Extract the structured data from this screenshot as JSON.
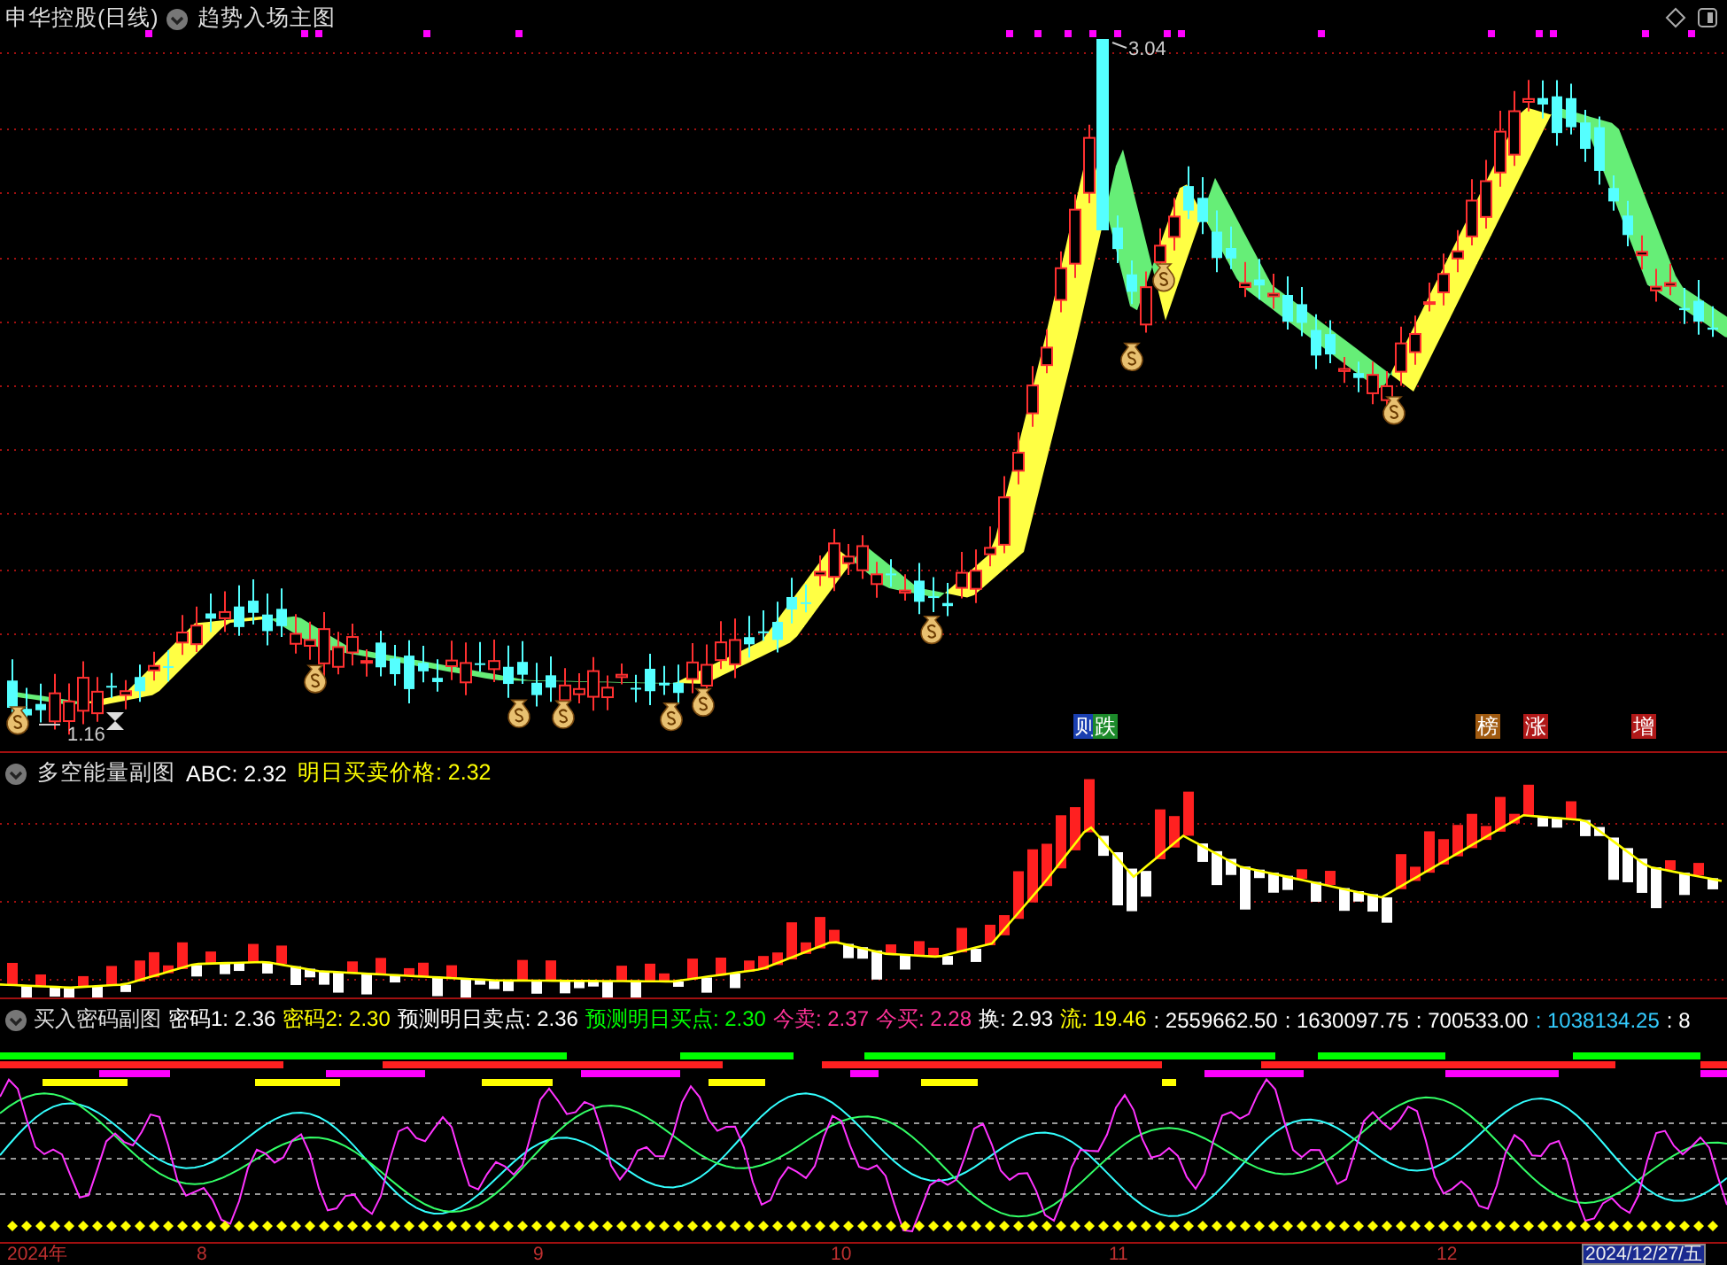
{
  "main_panel": {
    "stock_name": "申华控股(日线)",
    "indicator": "趋势入场主图",
    "high_label": "3.04",
    "low_label": "1.16",
    "signals": [
      {
        "text": "则",
        "color": "#1a3fb0"
      },
      {
        "text": "跌",
        "color": "#1c8a2a"
      },
      {
        "text": "榜",
        "color": "#a05a10"
      },
      {
        "text": "涨",
        "color": "#b01818"
      },
      {
        "text": "增",
        "color": "#b01818"
      }
    ]
  },
  "energy_panel": {
    "title": "多空能量副图",
    "values": [
      {
        "text": "ABC: 2.32",
        "color": "#ffffff"
      },
      {
        "text": "明日买卖价格: 2.32",
        "color": "#ffff00"
      }
    ]
  },
  "password_panel": {
    "title": "买入密码副图",
    "values": [
      {
        "text": "密码1: 2.36",
        "color": "#ffffff"
      },
      {
        "text": "密码2: 2.30",
        "color": "#ffff00"
      },
      {
        "text": "预测明日卖点: 2.36",
        "color": "#ffffff"
      },
      {
        "text": "预测明日买点: 2.30",
        "color": "#00ff00"
      },
      {
        "text": "今卖: 2.37",
        "color": "#ff3399"
      },
      {
        "text": "今买: 2.28",
        "color": "#ff3399"
      },
      {
        "text": "换: 2.93",
        "color": "#ffffff"
      },
      {
        "text": "流: 19.46",
        "color": "#ffff00"
      },
      {
        "text": ": 2559662.50",
        "color": "#ffffff"
      },
      {
        "text": ": 1630097.75",
        "color": "#ffffff"
      },
      {
        "text": ": 700533.00",
        "color": "#ffffff"
      },
      {
        "text": ": 1038134.25",
        "color": "#33ccff"
      },
      {
        "text": ": 8",
        "color": "#ffffff"
      }
    ]
  },
  "time_axis": [
    {
      "label": "2024年",
      "selected": false
    },
    {
      "label": "8",
      "selected": false
    },
    {
      "label": "9",
      "selected": false
    },
    {
      "label": "10",
      "selected": false
    },
    {
      "label": "11",
      "selected": false
    },
    {
      "label": "12",
      "selected": false
    },
    {
      "label": "2024/12/27/五",
      "selected": true
    }
  ]
}
